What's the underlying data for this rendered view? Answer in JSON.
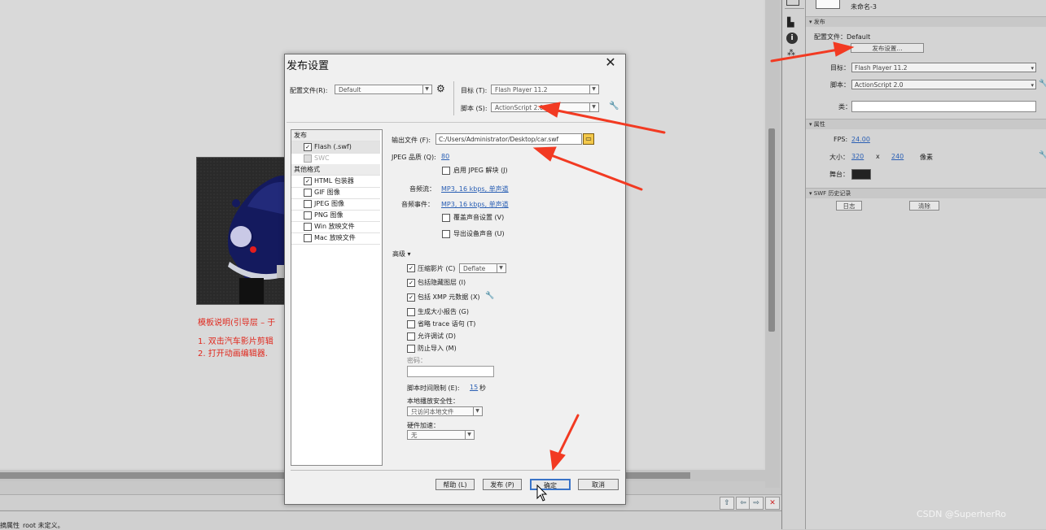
{
  "stage": {
    "template_desc": "模板说明(引导层 – 于",
    "steps": [
      "1. 双击汽车影片剪辑",
      "2. 打开动画编辑器."
    ],
    "status_left": "摘属性",
    "status_root": "root 未定义。"
  },
  "right_panel": {
    "doc_name": "未命名-3",
    "publish_section": "发布",
    "profile_label": "配置文件：Default",
    "publish_settings_btn": "发布设置...",
    "target_label": "目标：",
    "target_value": "Flash Player 11.2",
    "script_label": "脚本：",
    "script_value": "ActionScript 2.0",
    "class_label": "类：",
    "properties_section": "属性",
    "fps_label": "FPS:",
    "fps_value": "24.00",
    "size_label": "大小：",
    "width_value": "320",
    "size_x": "x",
    "height_value": "240",
    "size_unit": "像素",
    "stage_label": "舞台：",
    "swf_history_section": "SWF 历史记录",
    "log_btn": "日志",
    "clear_btn": "清除"
  },
  "dialog": {
    "title": "发布设置",
    "profile_label": "配置文件(R):",
    "profile_value": "Default",
    "target_label": "目标 (T):",
    "target_value": "Flash Player 11.2",
    "script_label": "脚本 (S):",
    "script_value": "ActionScript 2.0",
    "publish_header": "发布",
    "formats_header": "其他格式",
    "formats": [
      {
        "label": "Flash (.swf)",
        "checked": true,
        "selected": true
      },
      {
        "label": "SWC",
        "checked": false,
        "disabled": true
      },
      {
        "label": "HTML 包装器",
        "checked": true
      },
      {
        "label": "GIF 图像",
        "checked": false
      },
      {
        "label": "JPEG 图像",
        "checked": false
      },
      {
        "label": "PNG 图像",
        "checked": false
      },
      {
        "label": "Win 放映文件",
        "checked": false
      },
      {
        "label": "Mac 放映文件",
        "checked": false
      }
    ],
    "output_label": "输出文件 (F):",
    "output_value": "C:/Users/Administrator/Desktop/car.swf",
    "jpeg_quality_label": "JPEG 品质 (Q):",
    "jpeg_quality_value": "80",
    "jpeg_deblock": "启用 JPEG 解块 (J)",
    "audio_stream_label": "音频流：",
    "audio_stream_value": "MP3, 16 kbps, 单声道",
    "audio_event_label": "音频事件：",
    "audio_event_value": "MP3, 16 kbps, 单声道",
    "override_sound": "覆盖声音设置 (V)",
    "export_device_sound": "导出设备声音 (U)",
    "advanced_label": "高级",
    "compress_movie": "压缩影片 (C)",
    "compress_value": "Deflate",
    "include_hidden": "包括隐藏图层 (I)",
    "include_xmp": "包括 XMP 元数据 (X)",
    "size_report": "生成大小报告 (G)",
    "omit_trace": "省略 trace 语句 (T)",
    "permit_debug": "允许调试 (D)",
    "protect_import": "防止导入 (M)",
    "password_label": "密码：",
    "script_time_label": "脚本时间限制 (E):",
    "script_time_value": "15",
    "script_time_unit": "秒",
    "local_security_label": "本地播放安全性：",
    "local_security_value": "只访问本地文件",
    "hw_accel_label": "硬件加速：",
    "hw_accel_value": "无",
    "help_btn": "帮助 (L)",
    "publish_btn": "发布 (P)",
    "ok_btn": "确定",
    "cancel_btn": "取消"
  },
  "watermark": "CSDN @SuperherRo",
  "colors": {
    "annotation_arrow": "#f23a22",
    "template_text": "#e0271c",
    "link": "#2a5fb4"
  }
}
